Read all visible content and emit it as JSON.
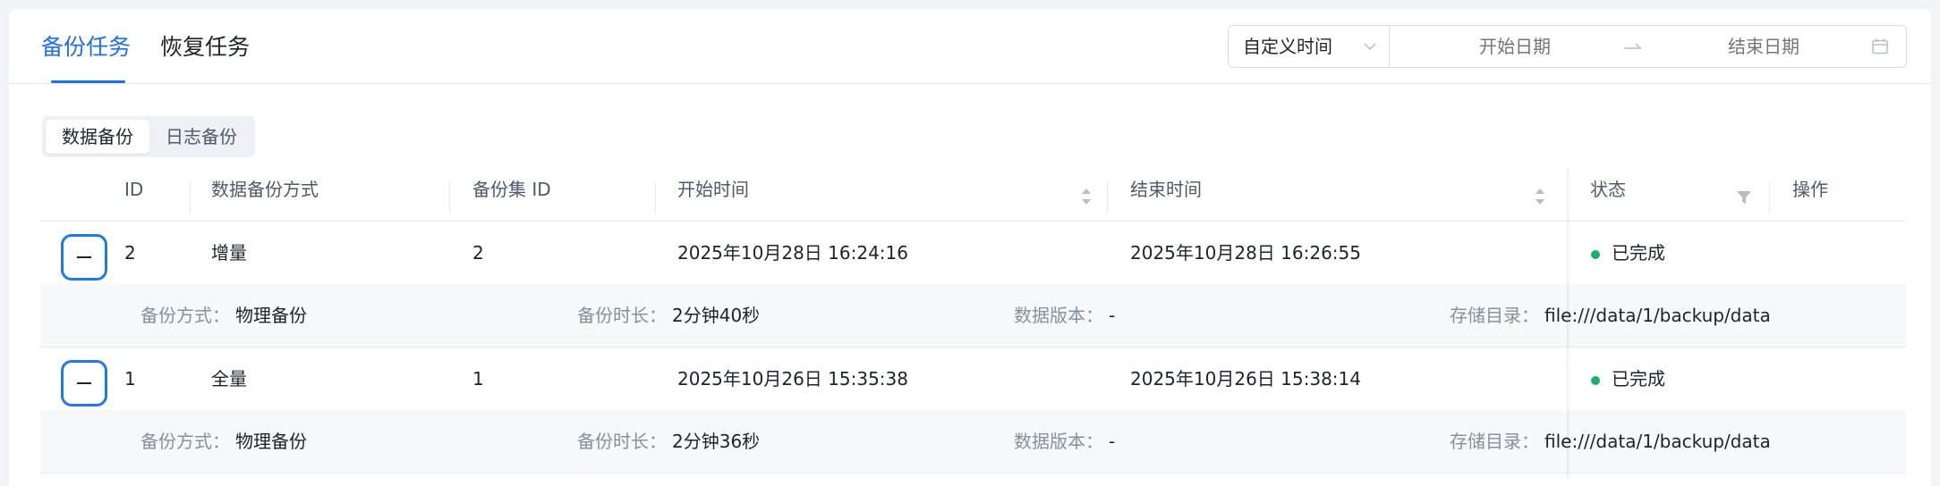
{
  "tabs": [
    {
      "label": "备份任务",
      "active": true
    },
    {
      "label": "恢复任务",
      "active": false
    }
  ],
  "time_filter": {
    "mode": "自定义时间",
    "start_placeholder": "开始日期",
    "end_placeholder": "结束日期"
  },
  "segments": [
    {
      "label": "数据备份",
      "active": true
    },
    {
      "label": "日志备份",
      "active": false
    }
  ],
  "table": {
    "columns": [
      "ID",
      "数据备份方式",
      "备份集 ID",
      "开始时间",
      "结束时间",
      "状态",
      "操作"
    ],
    "rows": [
      {
        "id": "2",
        "method": "增量",
        "set_id": "2",
        "start": "2025年10月28日 16:24:16",
        "end": "2025年10月28日 16:26:55",
        "status": "已完成",
        "detail": {
          "backup_type_label": "备份方式：",
          "backup_type": "物理备份",
          "duration_label": "备份时长：",
          "duration": "2分钟40秒",
          "version_label": "数据版本：",
          "version": "-",
          "dir_label": "存储目录：",
          "dir": "file:///data/1/backup/data"
        }
      },
      {
        "id": "1",
        "method": "全量",
        "set_id": "1",
        "start": "2025年10月26日 15:35:38",
        "end": "2025年10月26日 15:38:14",
        "status": "已完成",
        "detail": {
          "backup_type_label": "备份方式：",
          "backup_type": "物理备份",
          "duration_label": "备份时长：",
          "duration": "2分钟36秒",
          "version_label": "数据版本：",
          "version": "-",
          "dir_label": "存储目录：",
          "dir": "file:///data/1/backup/data"
        }
      }
    ]
  },
  "colors": {
    "accent": "#1f6fe5",
    "status_success": "#17b26a"
  }
}
